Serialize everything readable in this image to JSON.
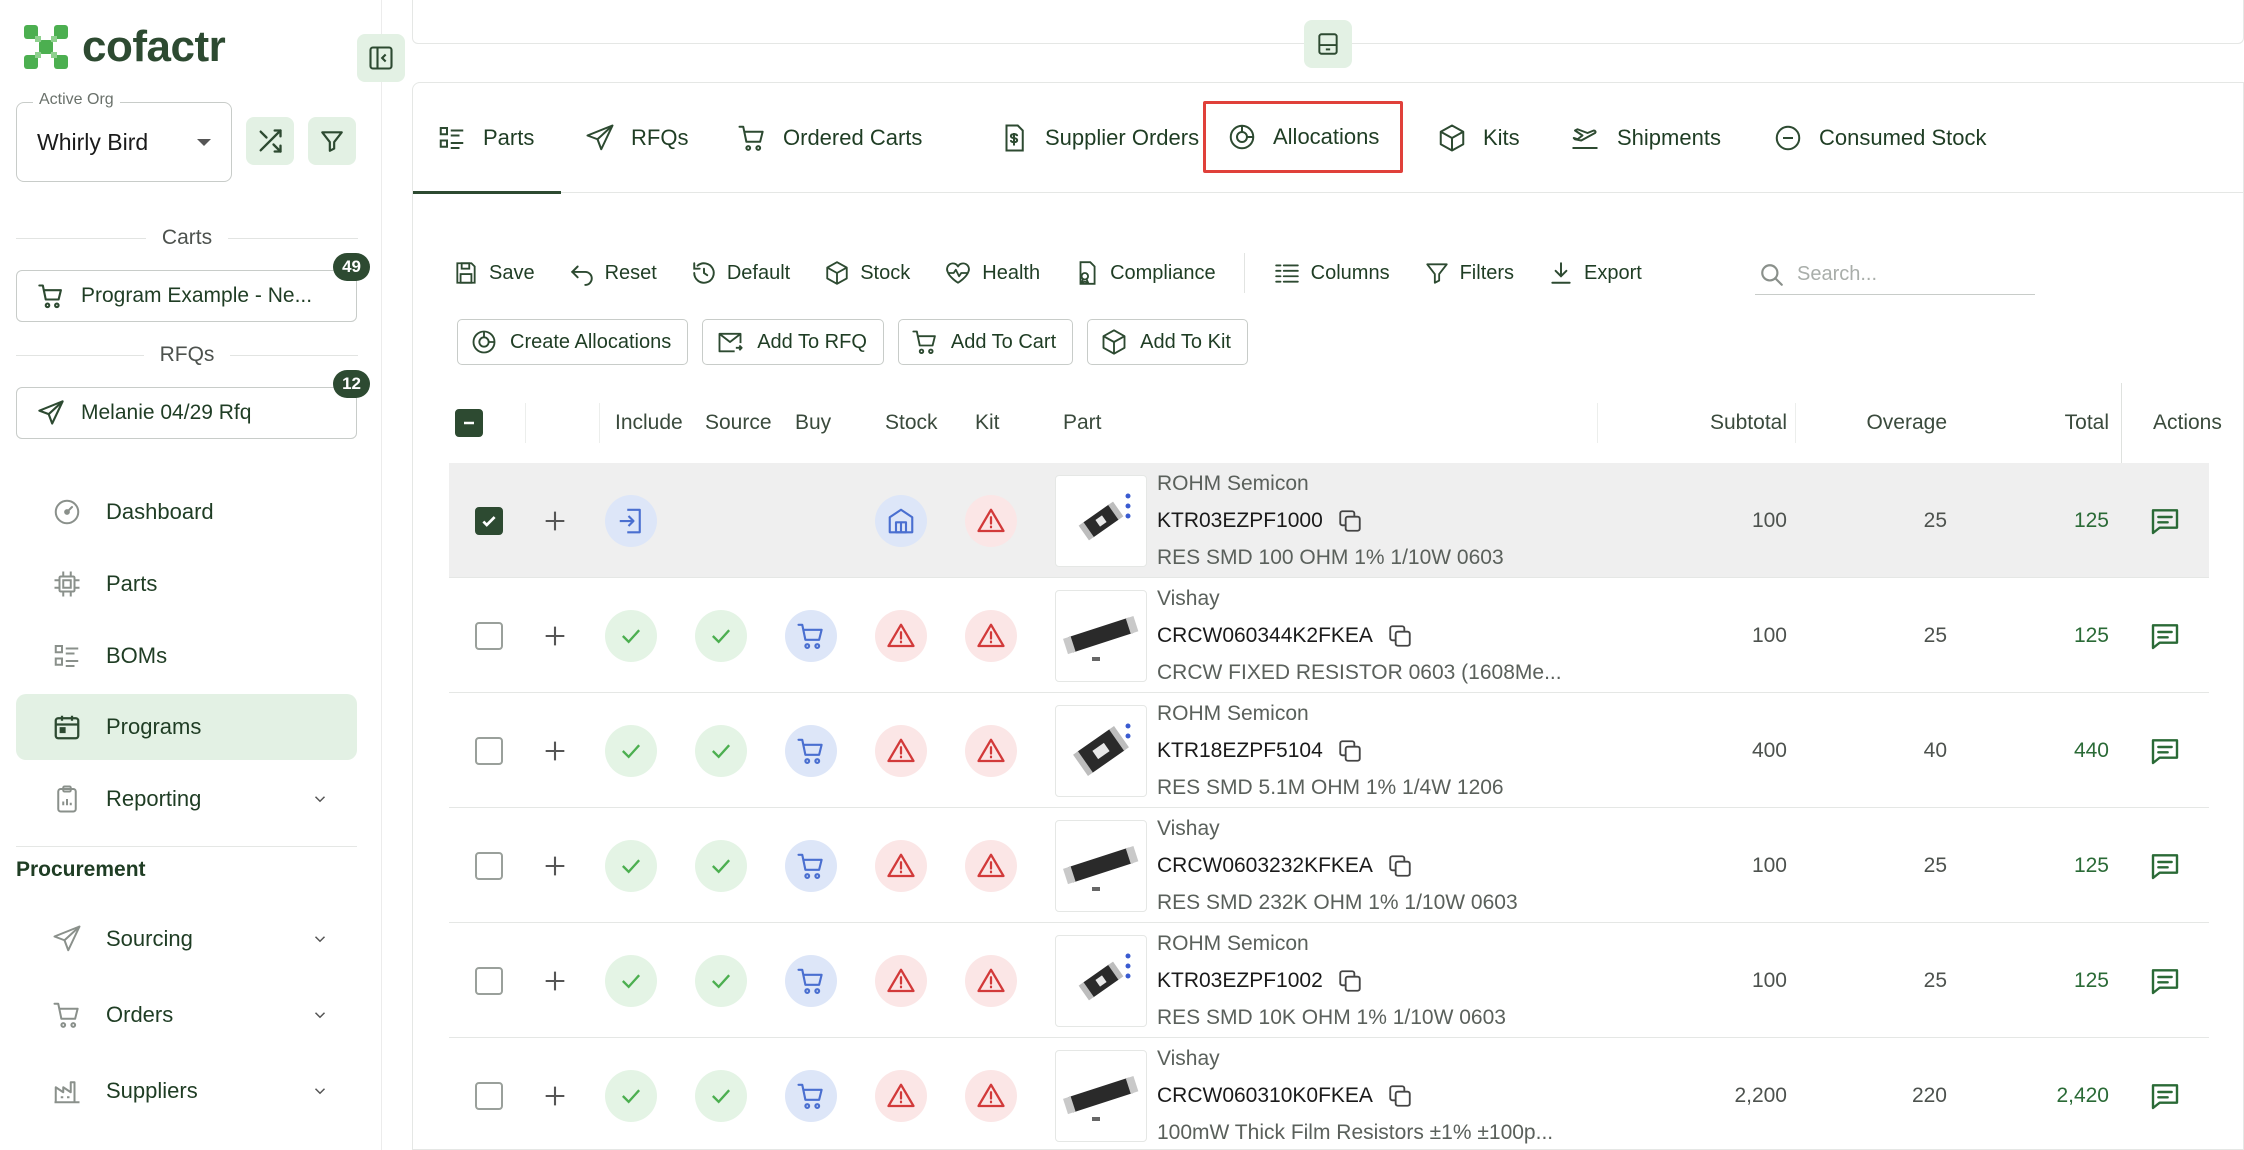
{
  "brand": {
    "name": "cofactr"
  },
  "org": {
    "label": "Active Org",
    "value": "Whirly Bird"
  },
  "carts": {
    "section": "Carts",
    "name": "Program Example - Ne...",
    "count": "49"
  },
  "rfqs": {
    "section": "RFQs",
    "name": "Melanie 04/29 Rfq",
    "count": "12"
  },
  "nav": {
    "dashboard": "Dashboard",
    "parts": "Parts",
    "boms": "BOMs",
    "programs": "Programs",
    "reporting": "Reporting",
    "procurement": "Procurement",
    "sourcing": "Sourcing",
    "orders": "Orders",
    "suppliers": "Suppliers"
  },
  "tabs": {
    "parts": "Parts",
    "rfqs": "RFQs",
    "ordered_carts": "Ordered Carts",
    "supplier_orders": "Supplier Orders",
    "allocations": "Allocations",
    "kits": "Kits",
    "shipments": "Shipments",
    "consumed_stock": "Consumed Stock"
  },
  "toolbar": {
    "save": "Save",
    "reset": "Reset",
    "default": "Default",
    "stock": "Stock",
    "health": "Health",
    "compliance": "Compliance",
    "columns": "Columns",
    "filters": "Filters",
    "export": "Export",
    "search_placeholder": "Search..."
  },
  "bulk_actions": {
    "create_allocations": "Create Allocations",
    "add_to_rfq": "Add To RFQ",
    "add_to_cart": "Add To Cart",
    "add_to_kit": "Add To Kit"
  },
  "table": {
    "headers": {
      "include": "Include",
      "source": "Source",
      "buy": "Buy",
      "stock": "Stock",
      "kit": "Kit",
      "part": "Part",
      "subtotal": "Subtotal",
      "overage": "Overage",
      "total": "Total",
      "actions": "Actions"
    },
    "rows": [
      {
        "manufacturer": "ROHM Semicon",
        "part_number": "KTR03EZPF1000",
        "description": "RES SMD 100 OHM 1% 1/10W 0603",
        "subtotal": "100",
        "overage": "25",
        "total": "125"
      },
      {
        "manufacturer": "Vishay",
        "part_number": "CRCW060344K2FKEA",
        "description": "CRCW FIXED RESISTOR 0603 (1608Me...",
        "subtotal": "100",
        "overage": "25",
        "total": "125"
      },
      {
        "manufacturer": "ROHM Semicon",
        "part_number": "KTR18EZPF5104",
        "description": "RES SMD 5.1M OHM 1% 1/4W 1206",
        "subtotal": "400",
        "overage": "40",
        "total": "440"
      },
      {
        "manufacturer": "Vishay",
        "part_number": "CRCW0603232KFKEA",
        "description": "RES SMD 232K OHM 1% 1/10W 0603",
        "subtotal": "100",
        "overage": "25",
        "total": "125"
      },
      {
        "manufacturer": "ROHM Semicon",
        "part_number": "KTR03EZPF1002",
        "description": "RES SMD 10K OHM 1% 1/10W 0603",
        "subtotal": "100",
        "overage": "25",
        "total": "125"
      },
      {
        "manufacturer": "Vishay",
        "part_number": "CRCW060310K0FKEA",
        "description": "100mW Thick Film Resistors ±1% ±100p...",
        "subtotal": "2,200",
        "overage": "220",
        "total": "2,420"
      }
    ]
  },
  "colors": {
    "brand_green": "#2d4a31",
    "light_green": "#e3f1e4",
    "accent_green": "#4caf50",
    "blue": "#5a7fd6",
    "red": "#d23a3a",
    "highlight": "#e0403a"
  }
}
